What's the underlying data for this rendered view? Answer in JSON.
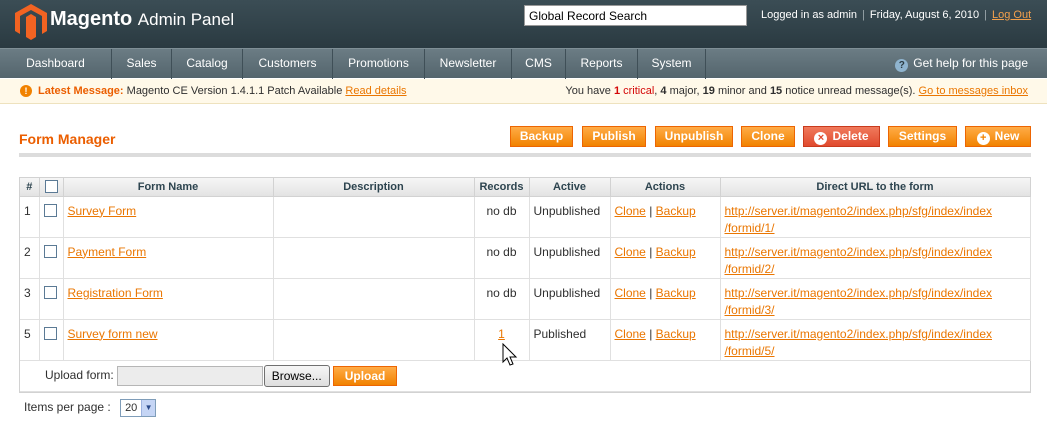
{
  "header": {
    "logo_main": "Magento",
    "logo_sub": "Admin Panel",
    "search_value": "Global Record Search",
    "logged_in": "Logged in as admin",
    "date": "Friday, August 6, 2010",
    "logout": "Log Out"
  },
  "nav": {
    "items": [
      "Dashboard",
      "Sales",
      "Catalog",
      "Customers",
      "Promotions",
      "Newsletter",
      "CMS",
      "Reports",
      "System"
    ],
    "help": "Get help for this page"
  },
  "message": {
    "label": "Latest Message:",
    "text": "Magento CE Version 1.4.1.1 Patch Available",
    "read_details": "Read details",
    "summary_prefix": "You have",
    "critical_count": "1",
    "critical_label": "critical",
    "major_count": "4",
    "major_label": "major",
    "minor_count": "19",
    "minor_label": "minor and",
    "notice_count": "15",
    "notice_label": "notice unread message(s).",
    "inbox_link": "Go to messages inbox"
  },
  "page": {
    "title": "Form Manager",
    "buttons": {
      "backup": "Backup",
      "publish": "Publish",
      "unpublish": "Unpublish",
      "clone": "Clone",
      "delete": "Delete",
      "settings": "Settings",
      "new": "New"
    }
  },
  "grid": {
    "headers": {
      "num": "#",
      "name": "Form Name",
      "description": "Description",
      "records": "Records",
      "active": "Active",
      "actions": "Actions",
      "url": "Direct URL to the form"
    },
    "action_clone": "Clone",
    "action_sep": "|",
    "action_backup": "Backup",
    "rows": [
      {
        "id": "1",
        "name": "Survey Form",
        "description": "",
        "records": "no db",
        "active": "Unpublished",
        "url_line1": "http://server.it/magento2/index.php/sfg/index/index",
        "url_line2": "/formid/1/"
      },
      {
        "id": "2",
        "name": "Payment Form",
        "description": "",
        "records": "no db",
        "active": "Unpublished",
        "url_line1": "http://server.it/magento2/index.php/sfg/index/index",
        "url_line2": "/formid/2/"
      },
      {
        "id": "3",
        "name": "Registration Form",
        "description": "",
        "records": "no db",
        "active": "Unpublished",
        "url_line1": "http://server.it/magento2/index.php/sfg/index/index",
        "url_line2": "/formid/3/"
      },
      {
        "id": "5",
        "name": "Survey form new",
        "description": "",
        "records": "1",
        "active": "Published",
        "url_line1": "http://server.it/magento2/index.php/sfg/index/index",
        "url_line2": "/formid/5/"
      }
    ],
    "upload_label": "Upload form:",
    "browse": "Browse...",
    "upload": "Upload"
  },
  "footer": {
    "items_per_page": "Items per page :",
    "per_page_value": "20"
  },
  "colors": {
    "accent": "#eb5e00",
    "button": "#f18200",
    "delete_button": "#e04a2e",
    "header_bg": "#2a3a41"
  }
}
